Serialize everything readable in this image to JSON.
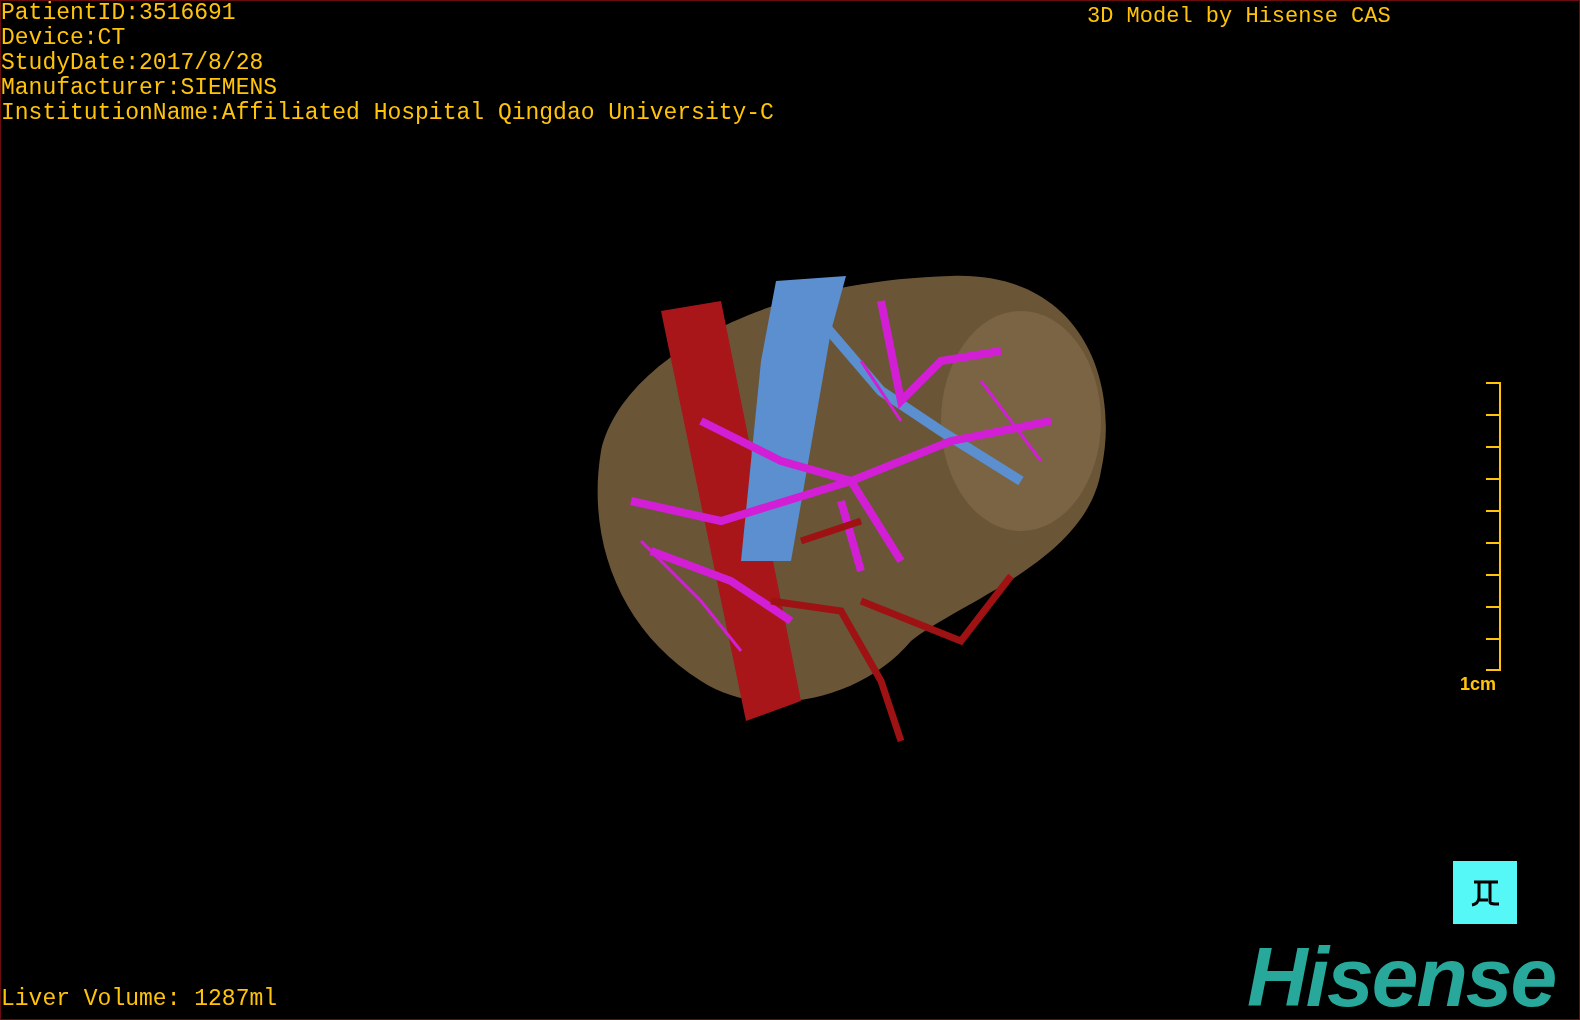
{
  "patient_info": [
    "PatientID:3516691",
    "Device:CT",
    "StudyDate:2017/8/28",
    "Manufacturer:SIEMENS",
    "InstitutionName:Affiliated Hospital Qingdao University-C"
  ],
  "model_credit": "3D Model by Hisense CAS",
  "scale_bar": {
    "label": "1cm"
  },
  "liver_volume": "Liver Volume: 1287ml",
  "logo": "Hisense"
}
